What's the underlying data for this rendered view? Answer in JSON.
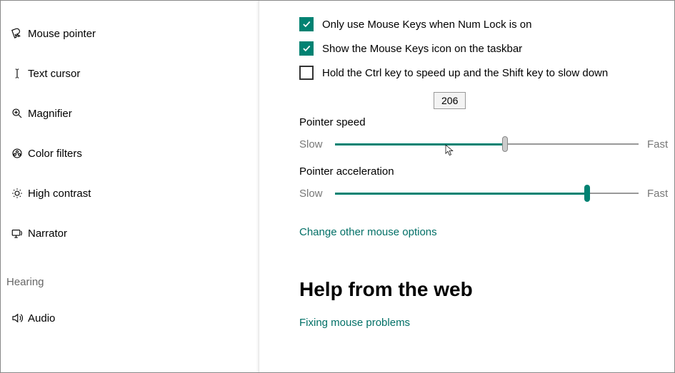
{
  "sidebar": {
    "items": [
      {
        "label": "Mouse pointer"
      },
      {
        "label": "Text cursor"
      },
      {
        "label": "Magnifier"
      },
      {
        "label": "Color filters"
      },
      {
        "label": "High contrast"
      },
      {
        "label": "Narrator"
      }
    ],
    "section_hearing": "Hearing",
    "item_audio": "Audio"
  },
  "checkboxes": {
    "numlock": {
      "label": "Only use Mouse Keys when Num Lock is on",
      "checked": true
    },
    "taskbar": {
      "label": "Show the Mouse Keys icon on the taskbar",
      "checked": true
    },
    "ctrlshift": {
      "label": "Hold the Ctrl key to speed up and the Shift key to slow down",
      "checked": false
    }
  },
  "tooltip_value": "206",
  "slider_speed": {
    "title": "Pointer speed",
    "min_label": "Slow",
    "max_label": "Fast",
    "percent": 55
  },
  "slider_accel": {
    "title": "Pointer acceleration",
    "min_label": "Slow",
    "max_label": "Fast",
    "percent": 82
  },
  "link_other": "Change other mouse options",
  "help_heading": "Help from the web",
  "help_link": "Fixing mouse problems"
}
